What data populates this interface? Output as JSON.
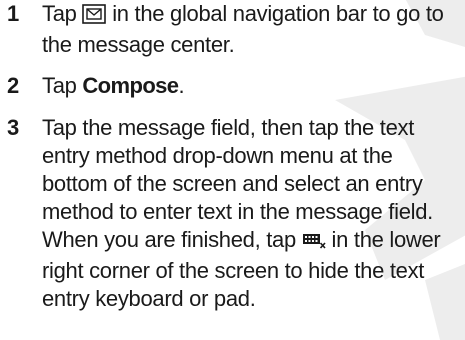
{
  "steps": [
    {
      "number": "1",
      "text_before": "Tap ",
      "icon": "message-center-icon",
      "text_after": " in the global navigation bar to go to the message center."
    },
    {
      "number": "2",
      "text_before": "Tap ",
      "bold": "Compose",
      "text_after": "."
    },
    {
      "number": "3",
      "text_before": "Tap the message field, then tap the text entry method drop-down menu at the bottom of the screen and select an entry method to enter text in the message field. When you are finished, tap ",
      "icon": "hide-keyboard-icon",
      "text_after": " in the lower right corner of the screen to hide the text entry keyboard or pad."
    }
  ],
  "watermark_color": "#ededed"
}
